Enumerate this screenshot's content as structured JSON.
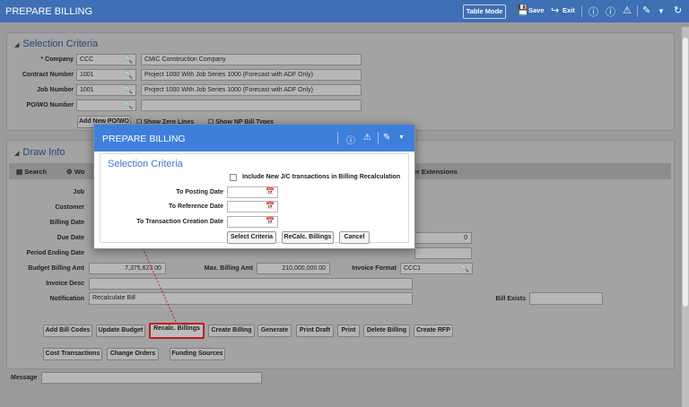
{
  "app": {
    "title": "PREPARE BILLING",
    "table_mode": "Table Mode",
    "save": "Save",
    "exit": "Exit"
  },
  "selection": {
    "title": "Selection Criteria",
    "company_label": "Company",
    "company_code": "CCC",
    "company_name": "CMiC Construction Company",
    "contract_label": "Contract Number",
    "contract_code": "1001",
    "contract_desc": "Project 1000 With Job Series 1000 (Forecast with ADF Only)",
    "job_label": "Job Number",
    "job_code": "1001",
    "job_desc": "Project 1000 With Job Series 1000 (Forecast with ADF Only)",
    "po_label": "PO/WO Number",
    "add_po": "Add New PO/WO",
    "show_zero": "Show Zero Lines",
    "show_np": "Show NP Bill Types"
  },
  "draw": {
    "title": "Draw Info",
    "search": "Search",
    "wo": "Wo",
    "user_ext": "User Extensions",
    "job_label": "Job",
    "customer_label": "Customer",
    "billing_date_label": "Billing Date",
    "due_date_label": "Due Date",
    "period_end_label": "Period Ending Date",
    "budget_label": "Budget Billing Amt",
    "budget_value": "7,375,623.00",
    "max_label": "Max. Billing Amt",
    "max_value": "210,000,000.00",
    "invoice_format_label": "Invoice Format",
    "invoice_format": "CCC1",
    "invoice_desc_label": "Invoice Desc",
    "notification_label": "Notification",
    "notification_value": "Recalculate Bill",
    "bill_exists_label": "Bill Exists",
    "zero_value": "0",
    "message_label": "Message"
  },
  "actions": {
    "add_bill_codes": "Add Bill Codes",
    "update_budget": "Update Budget",
    "recalc": "Recalc. Billings",
    "create_billing": "Create Billing",
    "generate": "Generate",
    "print_draft": "Print Draft",
    "print": "Print",
    "delete_billing": "Delete Billing",
    "create_rfp": "Create RFP",
    "cost_transactions": "Cost Transactions",
    "change_orders": "Change Orders",
    "funding_sources": "Funding Sources"
  },
  "modal": {
    "title": "PREPARE BILLING",
    "section": "Selection Criteria",
    "include_new": "Include New J/C transactions in Billing Recalculation",
    "to_posting": "To Posting Date",
    "to_reference": "To Reference Date",
    "to_transaction": "To Transaction Creation Date",
    "select_criteria": "Select Criteria",
    "recalc": "ReCalc. Billings",
    "cancel": "Cancel"
  },
  "colors": {
    "header_blue": "#3f6fb4",
    "modal_blue": "#3f7fdc",
    "highlight_red": "#c81818"
  }
}
